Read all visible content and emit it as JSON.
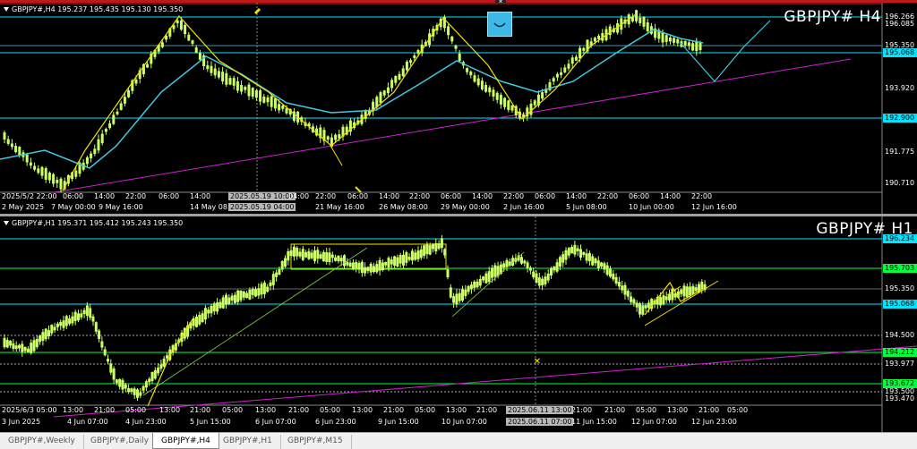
{
  "top_chart": {
    "info_line": "GBPJPY#,H4  195.237 195.435 195.130 195.350",
    "symbol_title": "GBPJPY#  H4",
    "price_labels": [
      {
        "text": "196.266",
        "highlight": false
      },
      {
        "text": "196.085",
        "highlight": false
      },
      {
        "text": "195.350",
        "highlight": false
      },
      {
        "text": "195.068",
        "highlight": true,
        "color": "#00e5ff"
      },
      {
        "text": "193.920",
        "highlight": false
      },
      {
        "text": "192.900",
        "highlight": true,
        "color": "#00e5ff"
      },
      {
        "text": "191.775",
        "highlight": false
      },
      {
        "text": "190.710",
        "highlight": false
      }
    ],
    "time_labels": [
      "2 May 2025",
      "7 May 00:00",
      "9 May 16:00",
      "14 May 08:00",
      "21 May 16:00",
      "26 May 08:00",
      "29 May 00:00",
      "2 Jun 16:00",
      "5 Jun 08:00",
      "10 Jun 00:00",
      "12 Jun 16:00"
    ],
    "candle_time_labels": [
      "2025/5/2 22:00",
      "06:00",
      "14:00",
      "22:00",
      "06:00",
      "14:00",
      "2025.05.19 10:00",
      "04:00",
      "22:00",
      "06:00",
      "14:00",
      "22:00",
      "06:00",
      "14:00",
      "22:00",
      "06:00",
      "14:00",
      "22:00",
      "06:00",
      "14:00",
      "22:00"
    ],
    "crosshair_labels": [
      "2025.05.19 10:00",
      "2025.05.19 04:00"
    ]
  },
  "bottom_chart": {
    "info_line": "GBPJPY#,H1  195.371 195.412 195.243 195.350",
    "symbol_title": "GBPJPY#  H1",
    "price_labels": [
      {
        "text": "196.234",
        "highlight": true,
        "color": "#00e5ff"
      },
      {
        "text": "195.703",
        "highlight": true,
        "color": "#00ff3c"
      },
      {
        "text": "195.350",
        "highlight": false
      },
      {
        "text": "195.068",
        "highlight": true,
        "color": "#00e5ff"
      },
      {
        "text": "194.500",
        "highlight": false
      },
      {
        "text": "194.212",
        "highlight": true,
        "color": "#00ff3c"
      },
      {
        "text": "193.977",
        "highlight": false
      },
      {
        "text": "193.672",
        "highlight": true,
        "color": "#00ff3c"
      },
      {
        "text": "193.500",
        "highlight": false
      },
      {
        "text": "193.470",
        "highlight": false
      }
    ],
    "time_labels": [
      "3 Jun 2025",
      "4 Jun 07:00",
      "4 Jun 23:00",
      "5 Jun 15:00",
      "6 Jun 07:00",
      "6 Jun 23:00",
      "9 Jun 15:00",
      "10 Jun 07:00",
      "10 Jun 23:00",
      "11 Jun 15:00",
      "12 Jun 07:00",
      "12 Jun 23:00"
    ],
    "candle_time_labels": [
      "2025/6/3 05:00",
      "13:00",
      "21:00",
      "05:00",
      "13:00",
      "21:00",
      "05:00",
      "13:00",
      "21:00",
      "05:00",
      "13:00",
      "21:00",
      "05:00",
      "13:00",
      "21:00",
      "05:00",
      "13:00",
      "21:00",
      "2025.06.11 13:00",
      "21:00",
      "05:00",
      "13:00",
      "21:00",
      "05:00"
    ],
    "crosshair_labels": [
      "2025.06.11 13:00",
      "2025.06.11 07:00"
    ]
  },
  "tabs": [
    {
      "label": "GBPJPY#,Weekly",
      "active": false
    },
    {
      "label": "GBPJPY#,Daily",
      "active": false
    },
    {
      "label": "GBPJPY#,H4",
      "active": true
    },
    {
      "label": "GBPJPY#,H1",
      "active": false
    },
    {
      "label": "GBPJPY#,M15",
      "active": false
    }
  ],
  "colors": {
    "candle": "#ccff66",
    "ma_line": "#40c8e0",
    "zigzag": "#f0e000",
    "trendline": "#d020d0",
    "level_cyan": "#00e5ff",
    "level_green": "#00ff3c"
  },
  "icons": {
    "trade_icon": "smile-trade-icon",
    "close_icon": "close-icon"
  }
}
